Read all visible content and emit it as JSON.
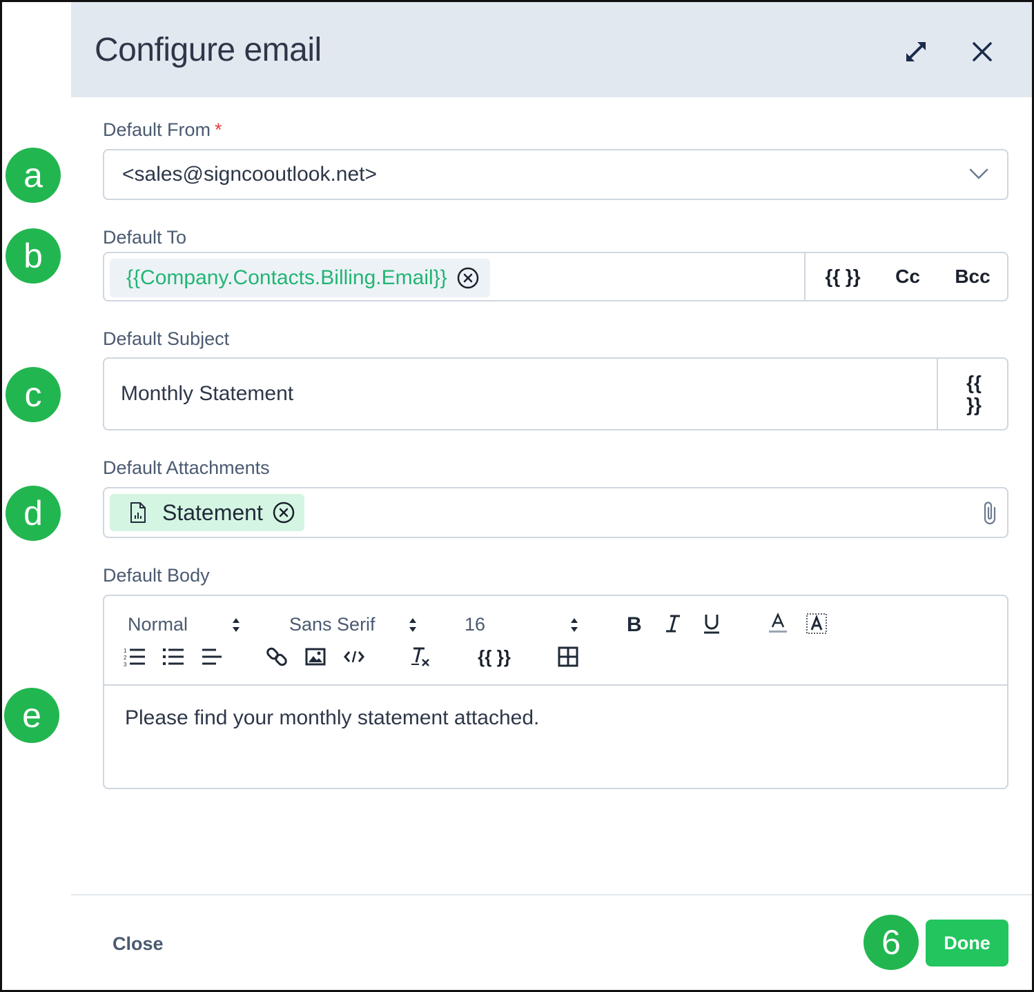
{
  "dialog": {
    "title": "Configure email"
  },
  "markers": {
    "a": "a",
    "b": "b",
    "c": "c",
    "d": "d",
    "e": "e",
    "done": "6"
  },
  "from": {
    "label": "Default From",
    "required_mark": "*",
    "value": "<sales@signcooutlook.net>"
  },
  "to": {
    "label": "Default To",
    "chip": "{{Company.Contacts.Billing.Email}}",
    "variable_button": "{{ }}",
    "cc_button": "Cc",
    "bcc_button": "Bcc"
  },
  "subject": {
    "label": "Default Subject",
    "value": "Monthly Statement",
    "variable_line1": "{{",
    "variable_line2": "}}"
  },
  "attachments": {
    "label": "Default Attachments",
    "chip": "Statement"
  },
  "body": {
    "label": "Default Body",
    "toolbar": {
      "format": "Normal",
      "font": "Sans Serif",
      "size": "16",
      "variable": "{{ }}"
    },
    "content": "Please find your monthly statement attached."
  },
  "footer": {
    "close_label": "Close",
    "done_label": "Done"
  },
  "colors": {
    "header_bg": "#e2e8f0",
    "accent_green": "#22c55e",
    "marker_green": "#22b650",
    "chip_text_green": "#22b573",
    "required_red": "#e53e3e"
  }
}
